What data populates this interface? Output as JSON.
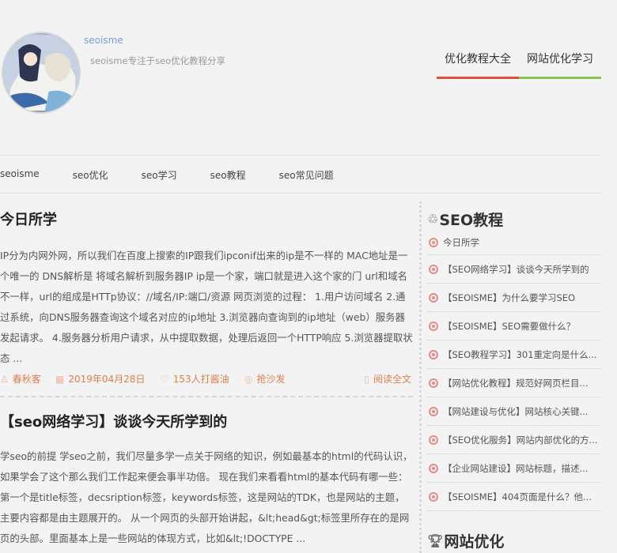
{
  "site": {
    "name": "seoisme",
    "description": "seoisme专注于seo优化教程分享"
  },
  "topnav": [
    {
      "label": "优化教程大全"
    },
    {
      "label": "网站优化学习"
    }
  ],
  "category_nav": [
    {
      "label": "seoisme"
    },
    {
      "label": "seo优化"
    },
    {
      "label": "seo学习"
    },
    {
      "label": "seo教程"
    },
    {
      "label": "seo常见问题"
    }
  ],
  "posts": [
    {
      "title": "今日所学",
      "excerpt": "IP分为内网外网，所以我们在百度上搜索的IP跟我们ipconif出来的ip是不一样的 MAC地址是一个唯一的 DNS解析是 将域名解析到服务器IP ip是一个家，端口就是进入这个家的门 url和域名不一样，url的组成是HTTp协议：//域名/IP:端口/资源 网页浏览的过程： 1.用户访问域名 2.通过系统，向DNS服务器查询这个域名对应的ip地址 3.浏览器向查询到的ip地址（web）服务器发起请求。 4.服务器分析用户请求，从中提取数据，处理后返回一个HTTP响应 5.浏览器提取状态 ...",
      "author": "春秋客",
      "date": "2019年04月28日",
      "likes": "153人打酱油",
      "comments": "抢沙发",
      "read_more": "阅读全文"
    },
    {
      "title": "【seo网络学习】谈谈今天所学到的",
      "excerpt": "学seo的前提 学seo之前，我们尽量多学一点关于网络的知识，例如最基本的html的代码认识，如果学会了这个那么我们工作起来便会事半功倍。 现在我们来看看html的基本代码有哪一些： 第一个是title标签，decsription标签，keywords标签，这是网站的TDK，也是网站的主题，主要内容都是由主题展开的。 从一个网页的头部开始讲起，&lt;head&gt;标签里所存在的是网页的头部。里面基本上是一些网站的体现方式，比如&lt;!DOCTYPE ..."
    }
  ],
  "sidebar": {
    "sections": [
      {
        "icon": "recycle-icon",
        "title": "SEO教程",
        "items": [
          "今日所学",
          "【SEO网络学习】谈谈今天所学到的",
          "【SEOISME】为什么要学习SEO",
          "【SEOISME】SEO需要做什么？",
          "【SEO教程学习】301重定向是什么...",
          "【网站优化教程】规范好网页栏目...",
          "【网站建设与优化】网站核心关键...",
          "【SEO优化服务】网站内部优化的方...",
          "【企业网站建设】网站标题，描述...",
          "【SEOISME】404页面是什么？他..."
        ]
      },
      {
        "icon": "trophy-icon",
        "title": "网站优化",
        "items": []
      }
    ]
  },
  "colors": {
    "accent_red": "#e0523e",
    "accent_green": "#8cc152",
    "meta_orange": "#e07d4e",
    "link_blue": "#7a9bd6"
  }
}
